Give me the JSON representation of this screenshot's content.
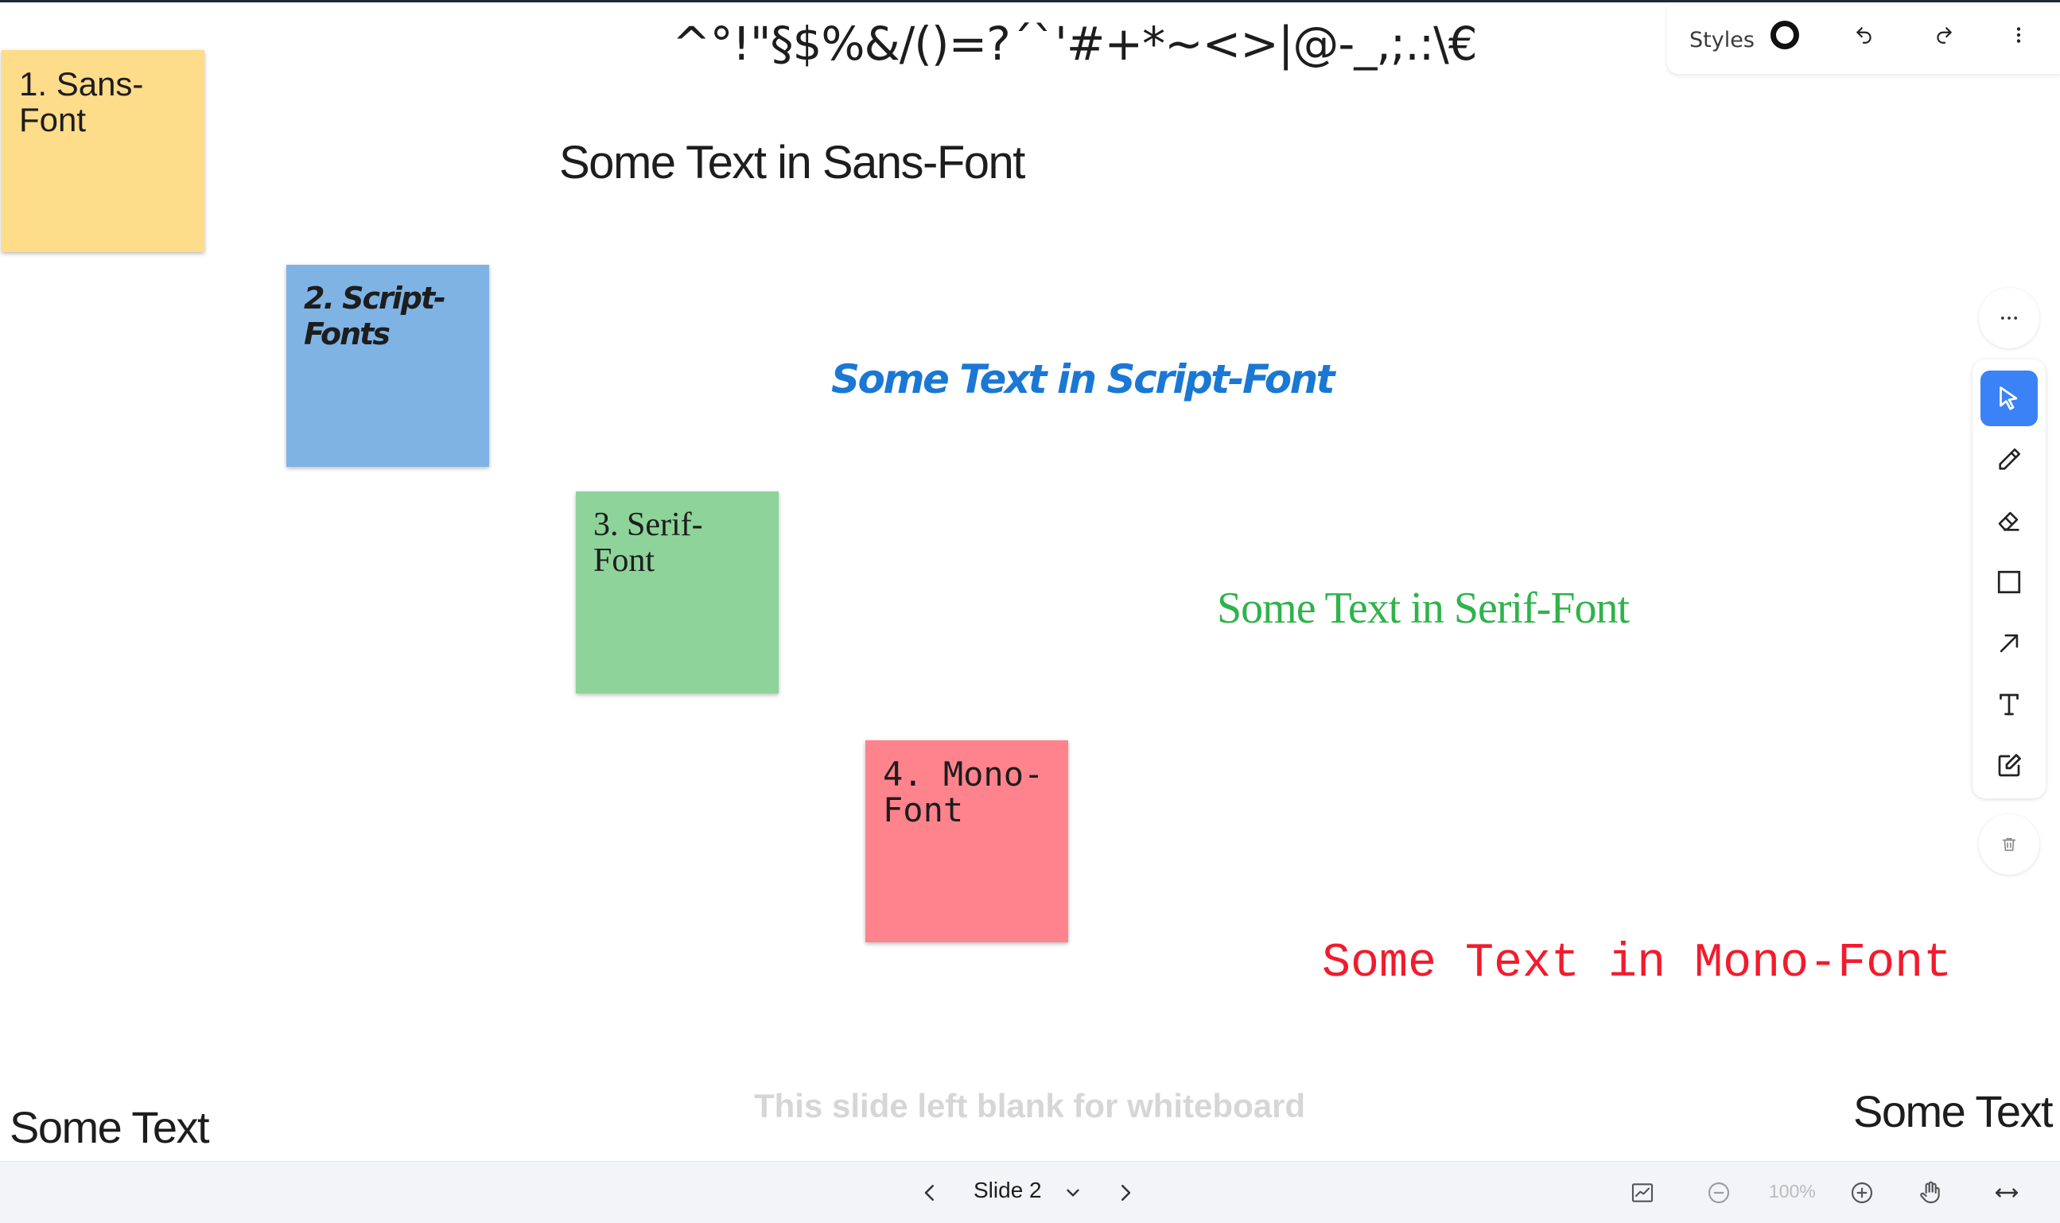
{
  "canvas": {
    "special_chars": "^°!\"§$%&/()=?´`'#+*~<>|@-_,;.:\\€",
    "texts": {
      "sans": "Some Text in Sans-Font",
      "script": "Some Text in Script-Font",
      "serif": "Some Text in Serif-Font",
      "mono": "Some Text in Mono-Font",
      "bottom_left": "Some Text",
      "bottom_right": "Some Text",
      "blank_note": "This slide left blank for whiteboard"
    },
    "stickies": [
      {
        "label": "1. Sans-Font",
        "color": "#fddc8a"
      },
      {
        "label": "2. Script-Fonts",
        "color": "#7fb3e4"
      },
      {
        "label": "3. Serif-Font",
        "color": "#8ed39a"
      },
      {
        "label": "4. Mono-Font",
        "color": "#ff838c"
      }
    ]
  },
  "style_panel": {
    "styles_label": "Styles",
    "icons": [
      "style-circle-icon",
      "undo-icon",
      "redo-icon",
      "kebab-menu-icon"
    ]
  },
  "toolbar": {
    "more_icon": "ellipsis-icon",
    "tools": [
      {
        "name": "select",
        "icon": "pointer-icon",
        "active": true
      },
      {
        "name": "draw",
        "icon": "pencil-icon",
        "active": false
      },
      {
        "name": "eraser",
        "icon": "eraser-icon",
        "active": false
      },
      {
        "name": "rectangle",
        "icon": "rectangle-icon",
        "active": false
      },
      {
        "name": "arrow",
        "icon": "arrow-icon",
        "active": false
      },
      {
        "name": "text",
        "icon": "text-icon",
        "active": false
      },
      {
        "name": "note",
        "icon": "note-icon",
        "active": false
      }
    ],
    "trash_icon": "trash-icon",
    "active_color": "#3b82f6"
  },
  "bottom_bar": {
    "slide_label": "Slide 2",
    "zoom_label": "100%"
  }
}
